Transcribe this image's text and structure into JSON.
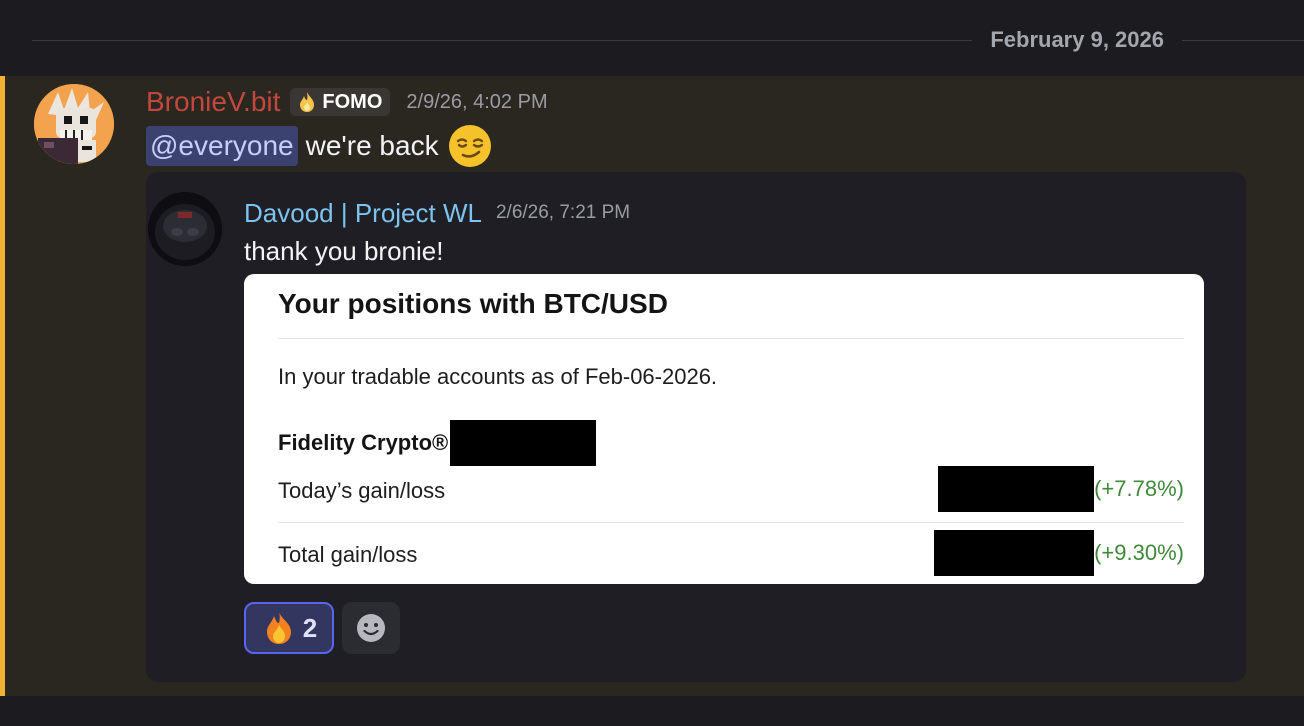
{
  "date_divider": "February 9, 2026",
  "message": {
    "author": "BronieV.bit",
    "role_tag": "FOMO",
    "timestamp": "2/9/26, 4:02 PM",
    "mention": "@everyone",
    "text": "we're back",
    "emoji_icon": "smirk-emoji-icon"
  },
  "forwarded": {
    "author": "Davood | Project WL",
    "timestamp": "2/6/26, 7:21 PM",
    "text": "thank you bronie!",
    "card": {
      "title": "Your positions with BTC/USD",
      "subtitle": "In your tradable accounts as of Feb-06-2026.",
      "account": "Fidelity Crypto®",
      "rows": [
        {
          "label": "Today’s gain/loss",
          "percent": "(+7.78%)"
        },
        {
          "label": "Total gain/loss",
          "percent": "(+9.30%)"
        }
      ]
    }
  },
  "reactions": [
    {
      "icon": "fire-emoji-icon",
      "count": "2"
    }
  ],
  "colors": {
    "author": "#c2473d",
    "forwarded_author": "#7cc3f0",
    "mention_bg": "#3c4270",
    "highlight_bar": "#f0b232",
    "gain": "#3f8a38"
  }
}
